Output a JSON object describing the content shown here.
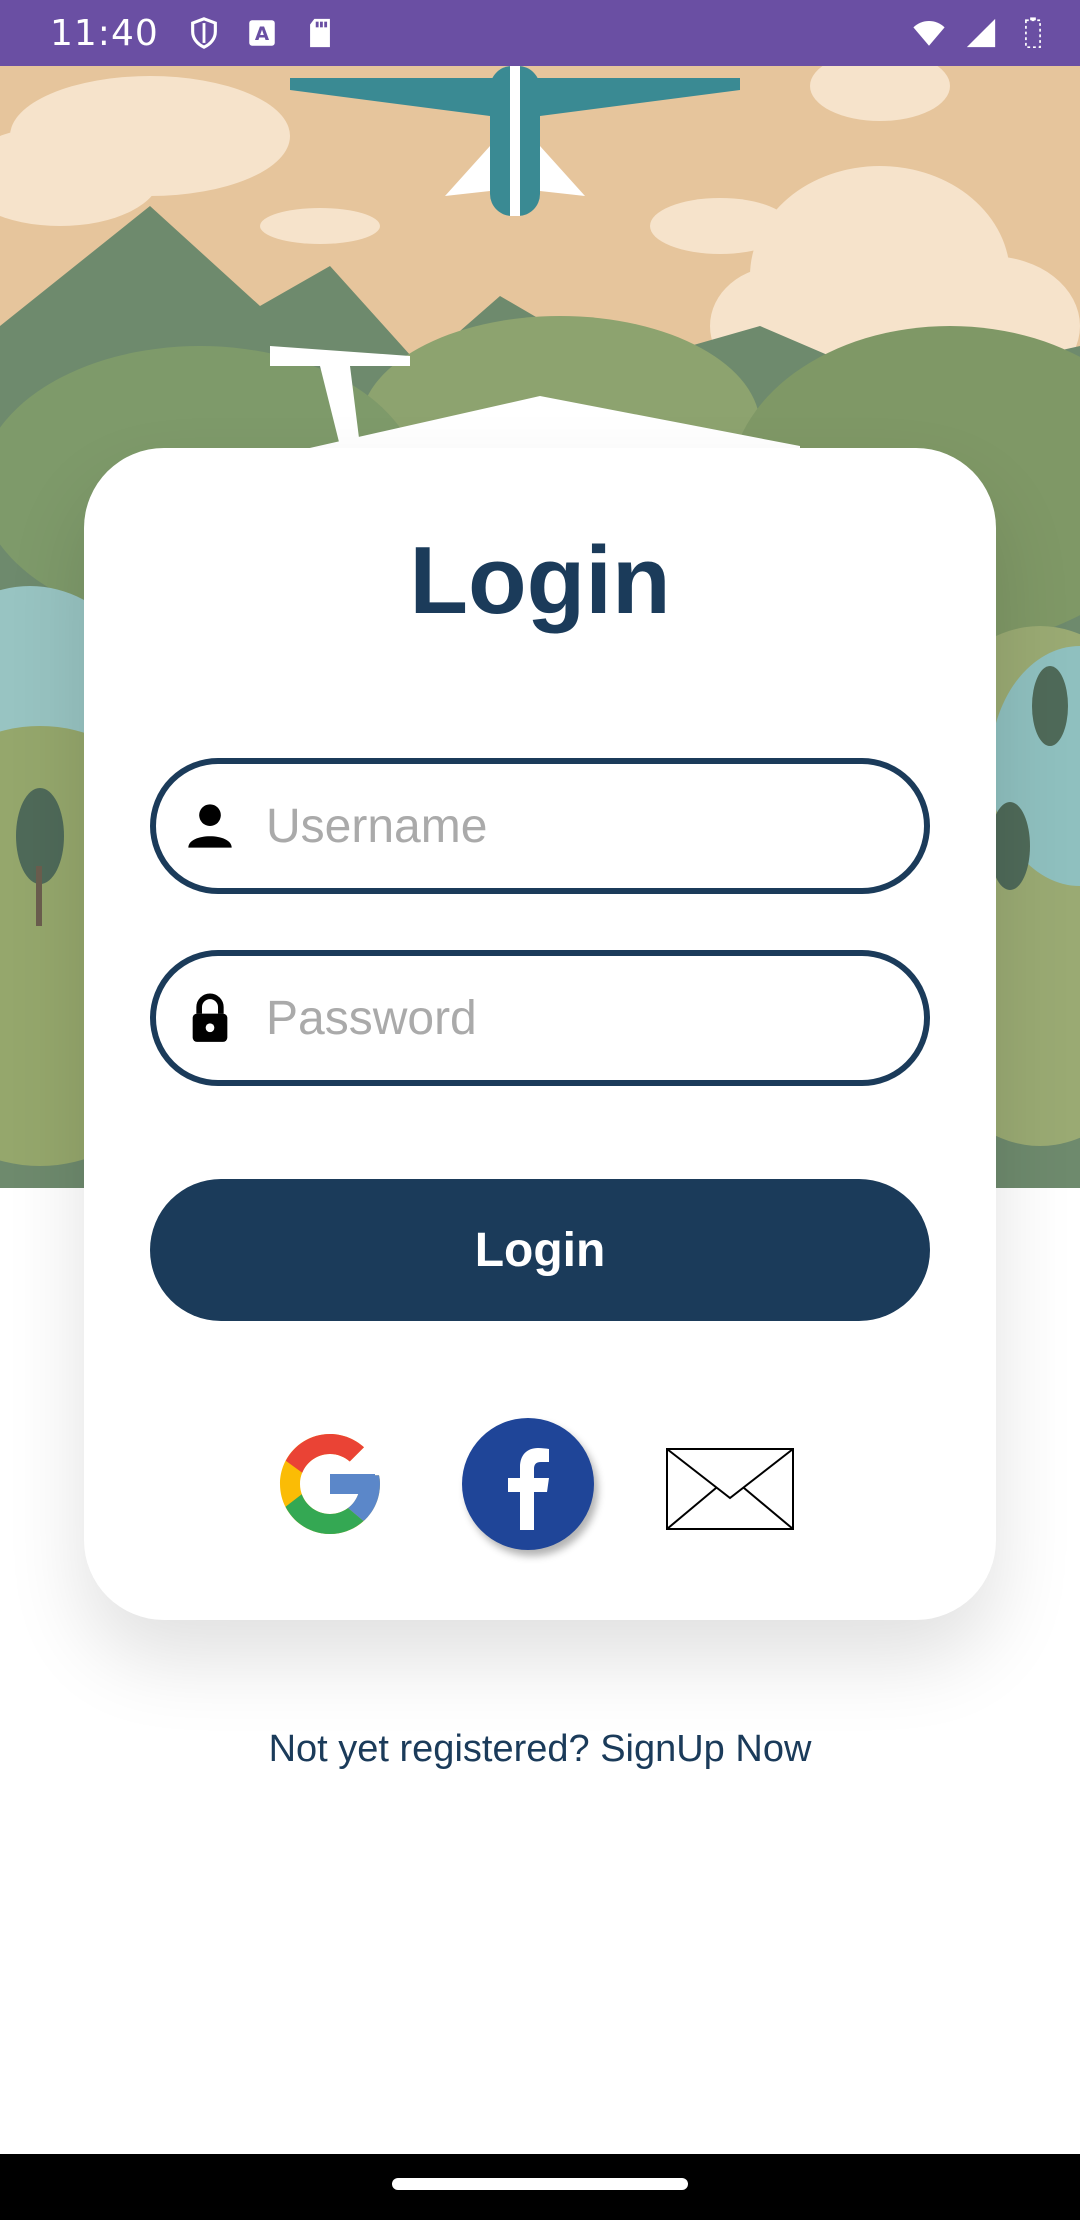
{
  "status_bar": {
    "time": "11:40",
    "icons_left": [
      "shield-icon",
      "text-a-icon",
      "sd-card-icon"
    ],
    "icons_right": [
      "wifi-icon",
      "cell-signal-icon",
      "battery-icon"
    ],
    "background": "#6a4fa3"
  },
  "login": {
    "title": "Login",
    "username_placeholder": "Username",
    "password_placeholder": "Password",
    "button_label": "Login",
    "accent": "#1b3b5a"
  },
  "social": {
    "items": [
      "google-icon",
      "facebook-icon",
      "mail-icon"
    ]
  },
  "signup_text": "Not yet registered? SignUp Now"
}
